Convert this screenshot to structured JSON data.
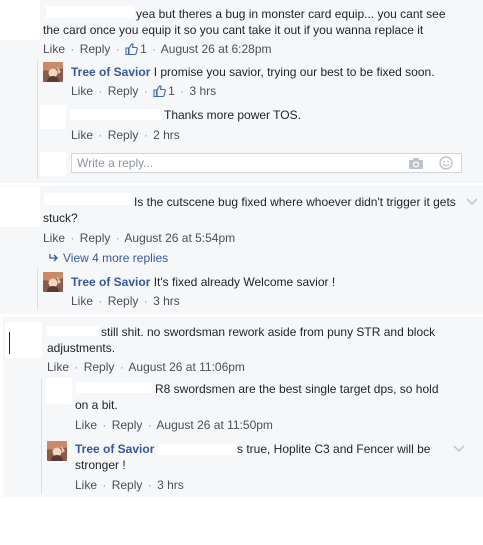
{
  "labels": {
    "like": "Like",
    "reply": "Reply",
    "dot": "·"
  },
  "colors": {
    "name_link": "#365899",
    "meta": "#90949c",
    "panel": "#f6f7f9",
    "text": "#1d2129"
  },
  "comments": [
    {
      "text_line1": "yea but theres a bug in monster card equip... you cant see",
      "text_line2": "the card once you equip it so you cant take it out if you wanna replace it",
      "likes": "1",
      "time": "August 26 at 6:28pm",
      "replies": [
        {
          "author": "Tree of Savior",
          "text": "I promise you savior, trying our best to be fixed soon.",
          "likes": "1",
          "time": "3 hrs"
        },
        {
          "author": "",
          "text": "Thanks more power TOS.",
          "time": "2 hrs"
        }
      ],
      "reply_placeholder": "Write a reply..."
    },
    {
      "text_line1": "Is the cutscene bug fixed where whoever didn't trigger it gets",
      "text_line2": "stuck?",
      "time": "August 26 at 5:54pm",
      "view_more": "View 4 more replies",
      "replies": [
        {
          "author": "Tree of Savior",
          "text": "It's fixed already Welcome savior !",
          "time": "3 hrs"
        }
      ]
    },
    {
      "text_line1": "still shit. no swordsman rework aside from puny STR and block",
      "text_line2": "adjustments.",
      "time": "August 26 at 11:06pm",
      "replies": [
        {
          "author": "",
          "text_line1": "R8 swordsmen are the best single target dps, so hold",
          "text_line2": "on a bit.",
          "time": "August 26 at 11:50pm"
        },
        {
          "author": "Tree of Savior",
          "text_line1": "s true, Hoplite C3 and Fencer will be",
          "text_line2": "stronger !",
          "time": "3 hrs"
        }
      ]
    }
  ]
}
